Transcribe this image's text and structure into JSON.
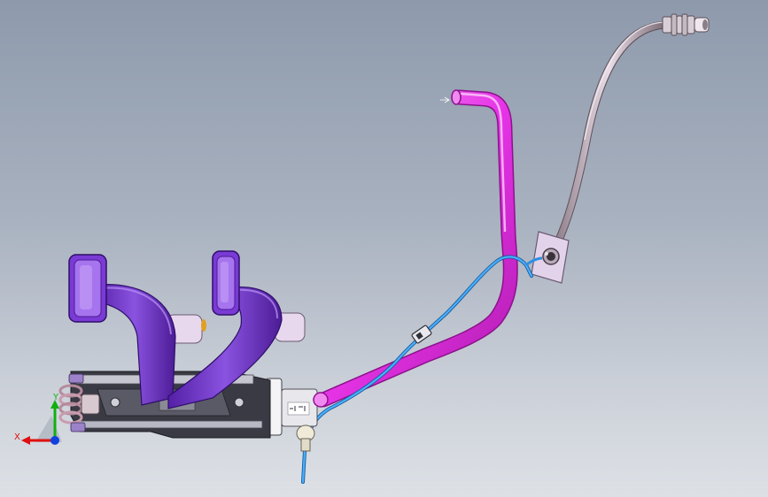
{
  "viewport": {
    "background_top": "#8e9aac",
    "background_bottom": "#dde1e6"
  },
  "model": {
    "pedal_color": "#6a2cc4",
    "pedal_highlight": "#9c6ee6",
    "pipe_color": "#e633e6",
    "pipe_highlight": "#f7a0f7",
    "hose_color": "#9a8a95",
    "line_color": "#2f8fe0",
    "bracket_color": "#e2d2ea"
  },
  "triad": {
    "x_label": "X",
    "y_label": "Y",
    "x_color": "#e01010",
    "y_color": "#10b010",
    "z_color": "#1040e0"
  }
}
